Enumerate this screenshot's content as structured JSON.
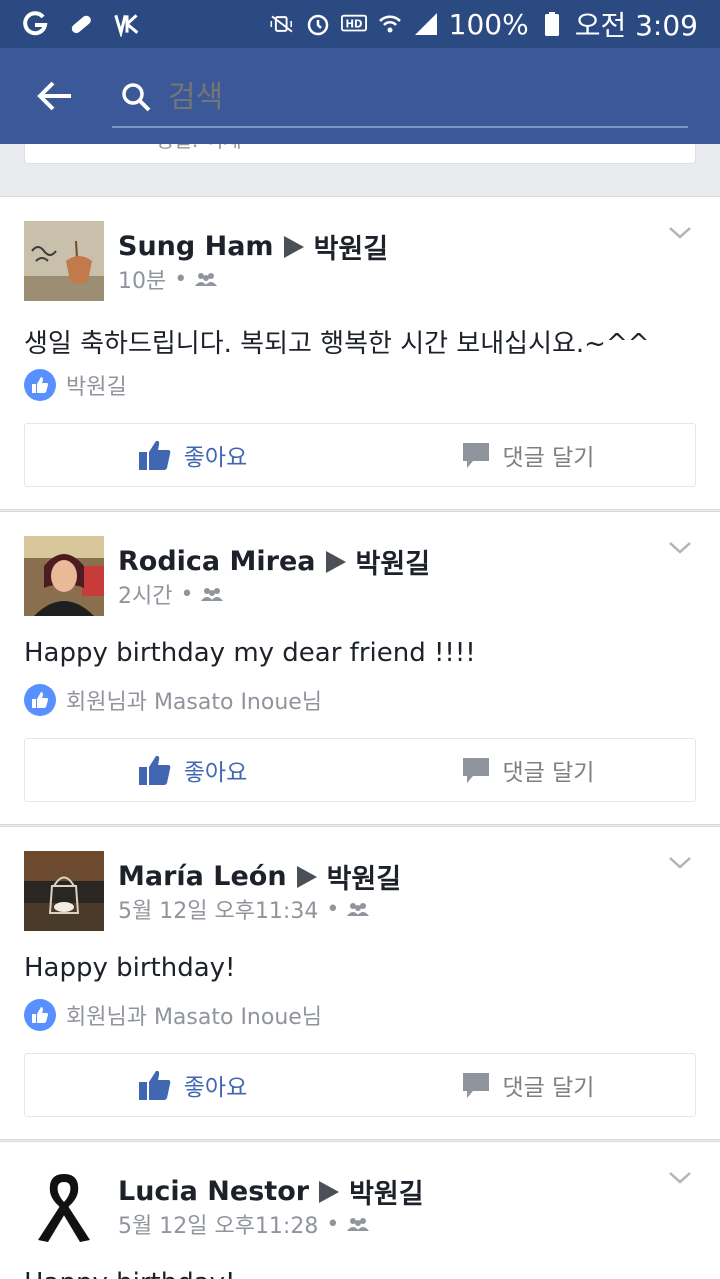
{
  "status_bar": {
    "battery": "100%",
    "time": "오전 3:09",
    "icons": [
      "g-icon",
      "pill-icon",
      "vk-icon",
      "mute-icon",
      "alarm-icon",
      "hd-icon",
      "wifi-icon",
      "signal-icon",
      "battery-icon"
    ]
  },
  "search": {
    "placeholder": "검색"
  },
  "previous_post": {
    "text": "생일: 어제"
  },
  "actions": {
    "like": "좋아요",
    "comment": "댓글 달기"
  },
  "posts": [
    {
      "author": "Sung Ham",
      "target": "박원길",
      "time": "10분",
      "text": "생일 축하드립니다. 복되고 행복한 시간 보내십시요.~^^",
      "likes": "박원길"
    },
    {
      "author": "Rodica Mirea",
      "target": "박원길",
      "time": "2시간",
      "text": "Happy birthday my dear friend !!!!",
      "likes": "회원님과 Masato Inoue님"
    },
    {
      "author": "María León",
      "target": "박원길",
      "time": "5월 12일 오후11:34",
      "text": "Happy birthday!",
      "likes": "회원님과 Masato Inoue님"
    },
    {
      "author": "Lucia Nestor",
      "target": "박원길",
      "time": "5월 12일 오후11:28",
      "text": "Happy birthday!",
      "likes": ""
    }
  ],
  "colors": {
    "status_bar": "#2c4a82",
    "app_bar": "#3b5998",
    "like_blue": "#5890ff",
    "action_blue": "#4267b2"
  }
}
